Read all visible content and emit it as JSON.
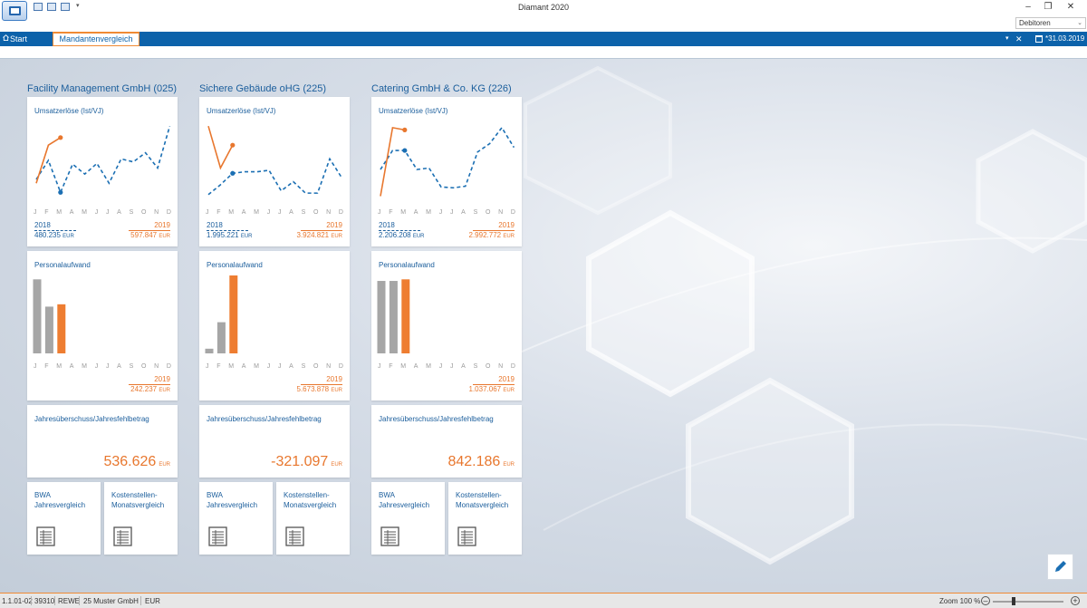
{
  "window": {
    "title": "Diamant 2020",
    "minimize": "–",
    "restore": "❐",
    "close": "✕",
    "qa_dropdown": "▾"
  },
  "context_select": {
    "value": "Debitoren"
  },
  "tabs": {
    "start_label": "Start",
    "active_label": "Mandantenvergleich",
    "menu_glyph": "▾",
    "close_glyph": "✕",
    "date": "*31.03.2019"
  },
  "months": [
    "J",
    "F",
    "M",
    "A",
    "M",
    "J",
    "J",
    "A",
    "S",
    "O",
    "N",
    "D"
  ],
  "labels": {
    "revenue_title": "Umsatzerlöse (Ist/VJ)",
    "personnel_title": "Personalaufwand",
    "result_title": "Jahresüberschuss/Jahresfehlbetrag",
    "bwa_label": "BWA\nJahresvergleich",
    "kst_label": "Kostenstellen-\nMonatsvergleich",
    "year_prev": "2018",
    "year_curr": "2019",
    "currency": "EUR"
  },
  "companies": [
    {
      "name": "Facility Management GmbH (025)",
      "revenue_prev_total": "480.235",
      "revenue_curr_total": "597.847",
      "personnel_curr_total": "242.237",
      "result": "536.626"
    },
    {
      "name": "Sichere Gebäude oHG (225)",
      "revenue_prev_total": "1.995.221",
      "revenue_curr_total": "3.924.821",
      "personnel_curr_total": "5.673.878",
      "result": "-321.097"
    },
    {
      "name": "Catering GmbH & Co. KG (226)",
      "revenue_prev_total": "2.206.208",
      "revenue_curr_total": "2.992.772",
      "personnel_curr_total": "1.037.067",
      "result": "842.186"
    }
  ],
  "chart_data": [
    {
      "type": "line",
      "company": "Facility Management GmbH (025)",
      "title": "Umsatzerlöse (Ist/VJ)",
      "categories": [
        "J",
        "F",
        "M",
        "A",
        "M",
        "J",
        "J",
        "A",
        "S",
        "O",
        "N",
        "D"
      ],
      "series": [
        {
          "name": "2018",
          "values": [
            0.25,
            0.5,
            0.08,
            0.45,
            0.32,
            0.46,
            0.2,
            0.52,
            0.48,
            0.6,
            0.4,
            0.95
          ]
        },
        {
          "name": "2019",
          "values": [
            0.2,
            0.7,
            0.8
          ]
        }
      ],
      "ylim": [
        0,
        1
      ]
    },
    {
      "type": "bar",
      "company": "Facility Management GmbH (025)",
      "title": "Personalaufwand",
      "categories": [
        "J",
        "F",
        "M",
        "A",
        "M",
        "J",
        "J",
        "A",
        "S",
        "O",
        "N",
        "D"
      ],
      "series": [
        {
          "name": "2018",
          "values": [
            0.95,
            0.6
          ]
        },
        {
          "name": "2019",
          "values": [
            null,
            null,
            0.63
          ]
        }
      ],
      "ylim": [
        0,
        1
      ]
    },
    {
      "type": "line",
      "company": "Sichere Gebäude oHG (225)",
      "title": "Umsatzerlöse (Ist/VJ)",
      "categories": [
        "J",
        "F",
        "M",
        "A",
        "M",
        "J",
        "J",
        "A",
        "S",
        "O",
        "N",
        "D"
      ],
      "series": [
        {
          "name": "2018",
          "values": [
            0.05,
            0.18,
            0.33,
            0.35,
            0.35,
            0.37,
            0.1,
            0.22,
            0.07,
            0.07,
            0.52,
            0.27
          ]
        },
        {
          "name": "2019",
          "values": [
            0.95,
            0.4,
            0.7
          ]
        }
      ],
      "ylim": [
        0,
        1
      ]
    },
    {
      "type": "bar",
      "company": "Sichere Gebäude oHG (225)",
      "title": "Personalaufwand",
      "categories": [
        "J",
        "F",
        "M",
        "A",
        "M",
        "J",
        "J",
        "A",
        "S",
        "O",
        "N",
        "D"
      ],
      "series": [
        {
          "name": "2018",
          "values": [
            0.06,
            0.4
          ]
        },
        {
          "name": "2019",
          "values": [
            null,
            null,
            1.0
          ]
        }
      ],
      "ylim": [
        0,
        1
      ]
    },
    {
      "type": "line",
      "company": "Catering GmbH & Co. KG (226)",
      "title": "Umsatzerlöse (Ist/VJ)",
      "categories": [
        "J",
        "F",
        "M",
        "A",
        "M",
        "J",
        "J",
        "A",
        "S",
        "O",
        "N",
        "D"
      ],
      "series": [
        {
          "name": "2018",
          "values": [
            0.38,
            0.63,
            0.63,
            0.38,
            0.4,
            0.15,
            0.14,
            0.16,
            0.61,
            0.72,
            0.93,
            0.67
          ]
        },
        {
          "name": "2019",
          "values": [
            0.03,
            0.93,
            0.9
          ]
        }
      ],
      "ylim": [
        0,
        1
      ]
    },
    {
      "type": "bar",
      "company": "Catering GmbH & Co. KG (226)",
      "title": "Personalaufwand",
      "categories": [
        "J",
        "F",
        "M",
        "A",
        "M",
        "J",
        "J",
        "A",
        "S",
        "O",
        "N",
        "D"
      ],
      "series": [
        {
          "name": "2018",
          "values": [
            0.93,
            0.93
          ]
        },
        {
          "name": "2019",
          "values": [
            null,
            null,
            0.95
          ]
        }
      ],
      "ylim": [
        0,
        1
      ]
    }
  ],
  "statusbar": {
    "version": "1.1.01-02",
    "client_no": "39310",
    "plan": "REWE",
    "company": "25 Muster GmbH",
    "currency": "EUR",
    "zoom": "Zoom 100 %",
    "zoom_out": "–",
    "zoom_in": "+"
  },
  "colors": {
    "prev_year": "#1b6fb3",
    "curr_year": "#e8772e",
    "bar_prev": "#a6a6a6",
    "bar_curr": "#ee7d31",
    "accent": "#0c62aa"
  },
  "icons": {
    "edit": "pencil-icon",
    "document": "document-icon",
    "home": "home-icon",
    "calendar": "calendar-icon"
  }
}
